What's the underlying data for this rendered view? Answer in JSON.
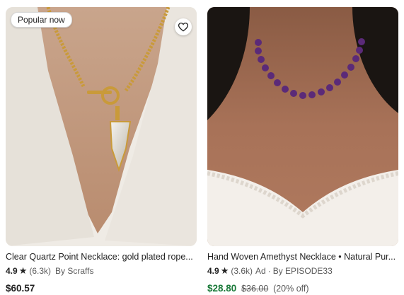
{
  "listings": [
    {
      "badge": "Popular now",
      "title": "Clear Quartz Point Necklace: gold plated rope...",
      "rating": "4.9",
      "reviews": "(6.3k)",
      "seller": "By Scraffs",
      "price": "$60.57",
      "original_price": "",
      "discount": "",
      "ad_label": ""
    },
    {
      "badge": "",
      "title": "Hand Woven Amethyst Necklace • Natural Pur...",
      "rating": "4.9",
      "reviews": "(3.6k)",
      "ad_label": "Ad",
      "seller": "By EPISODE33",
      "price": "$28.80",
      "original_price": "$36.00",
      "discount": "(20% off)"
    }
  ],
  "icons": {
    "favorite": "heart-outline-icon",
    "rating": "star-icon"
  },
  "colors": {
    "sale_price": "#1b7a3a",
    "text": "#222222",
    "muted": "#595959"
  }
}
